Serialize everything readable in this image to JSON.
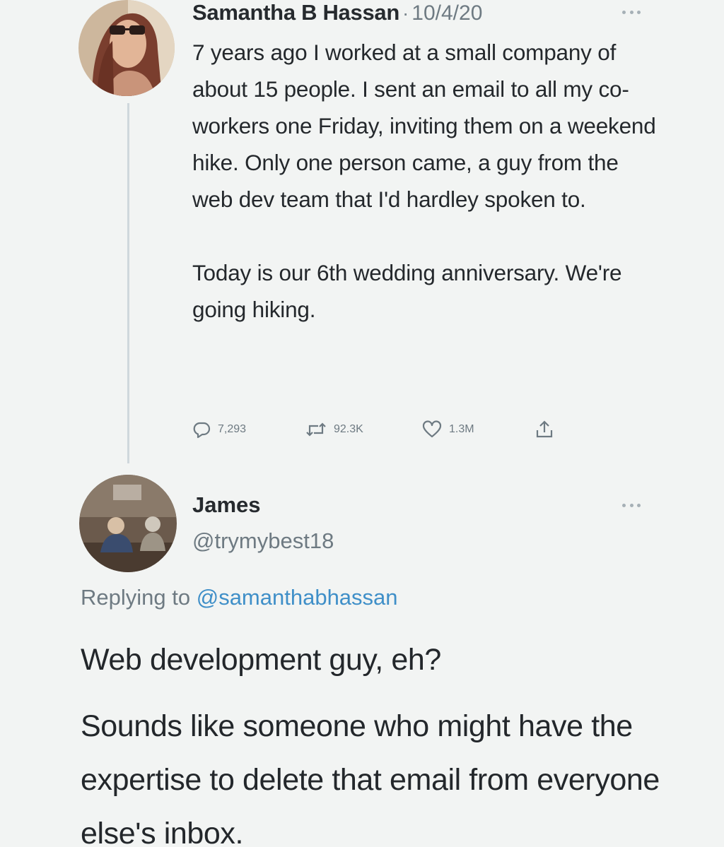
{
  "original_tweet": {
    "author_name": "Samantha B Hassan",
    "separator": "·",
    "date": "10/4/20",
    "paragraph_1": "7 years ago I worked at a small company of about 15 people. I sent an email to all my co-workers one Friday, inviting them on a weekend hike. Only one person came, a guy from the web dev team that I'd hardley spoken to.",
    "paragraph_2": "Today is our 6th wedding anniversary. We're going hiking.",
    "actions": {
      "replies": "7,293",
      "retweets": "92.3K",
      "likes": "1.3M"
    },
    "icons": [
      "more-icon",
      "reply-icon",
      "retweet-icon",
      "like-icon",
      "share-icon"
    ]
  },
  "reply_tweet": {
    "author_name": "James",
    "handle": "@trymybest18",
    "replying_prefix": "Replying to",
    "replying_mention": "@samanthabhassan",
    "paragraph_1": "Web development guy, eh?",
    "paragraph_2": "Sounds like someone who might have the expertise to delete that email from everyone else's inbox.",
    "icons": [
      "more-icon"
    ]
  },
  "colors": {
    "background": "#f2f4f3",
    "text": "#24282c",
    "muted": "#6e7a82",
    "mention": "#3f8fc8",
    "thread_line": "#cfd7dc"
  }
}
